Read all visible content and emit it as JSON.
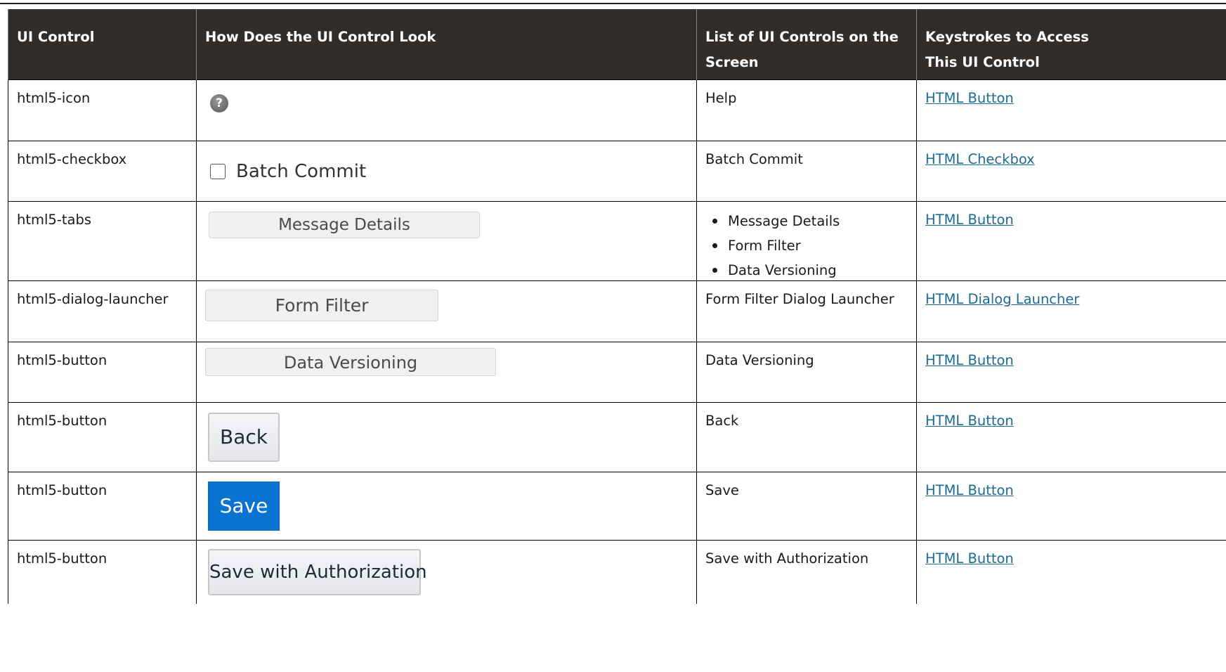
{
  "table": {
    "headers": [
      "UI Control",
      "How Does the UI Control Look",
      "List of UI Controls on the Screen",
      "Keystrokes to Access This UI Control"
    ],
    "header_lines": {
      "col3_line1": "List of UI Controls on the",
      "col3_line2": "Screen",
      "col4_line1": "Keystrokes to Access",
      "col4_line2": "This UI Control"
    },
    "rows": [
      {
        "control": "html5-icon",
        "look": {
          "type": "help-icon",
          "icon": "question-mark-icon",
          "glyph": "?"
        },
        "list": "Help",
        "keystroke": "HTML Button"
      },
      {
        "control": "html5-checkbox",
        "look": {
          "type": "checkbox",
          "label": "Batch Commit"
        },
        "list": "Batch Commit",
        "keystroke": "HTML Checkbox"
      },
      {
        "control": "html5-tabs",
        "look": {
          "type": "tab",
          "label": "Message Details"
        },
        "list_items": [
          "Message Details",
          "Form Filter",
          "Data Versioning"
        ],
        "keystroke": "HTML Button"
      },
      {
        "control": "html5-dialog-launcher",
        "look": {
          "type": "tab",
          "label": "Form Filter"
        },
        "list": "Form Filter Dialog Launcher",
        "keystroke": "HTML Dialog Launcher"
      },
      {
        "control": "html5-button",
        "look": {
          "type": "tab",
          "label": "Data Versioning"
        },
        "list": "Data Versioning",
        "keystroke": "HTML Button"
      },
      {
        "control": "html5-button",
        "look": {
          "type": "button",
          "label": "Back"
        },
        "list": "Back",
        "keystroke": "HTML Button"
      },
      {
        "control": "html5-button",
        "look": {
          "type": "primary-button",
          "label": "Save"
        },
        "list": "Save",
        "keystroke": "HTML Button"
      },
      {
        "control": "html5-button",
        "look": {
          "type": "button",
          "label": "Save with Authorization"
        },
        "list": "Save with Authorization",
        "keystroke": "HTML Button"
      }
    ]
  },
  "colors": {
    "header_bg": "#312d2a",
    "header_text": "#ffffff",
    "link": "#1b6b93",
    "primary_button": "#0a72d1",
    "tab_bg": "#f0f0f0"
  }
}
